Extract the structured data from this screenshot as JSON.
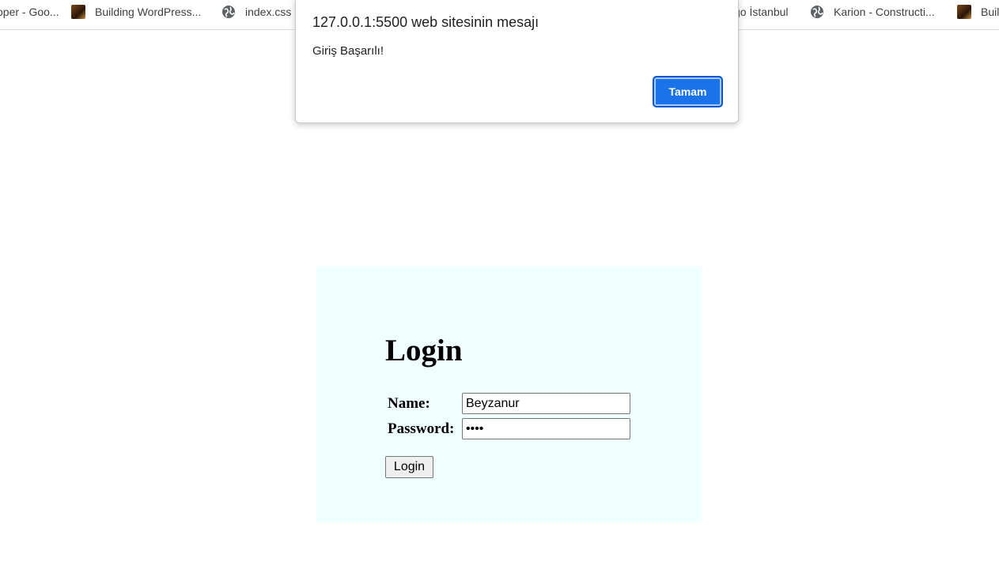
{
  "bookmarks": [
    {
      "label": "oper - Goo...",
      "icon": "globe-icon"
    },
    {
      "label": "Building WordPress...",
      "icon": "site-thumbnail-icon"
    },
    {
      "label": "index.css",
      "icon": "globe-icon"
    },
    {
      "label": "go İstanbul",
      "icon": "none"
    },
    {
      "label": "Karion - Constructi...",
      "icon": "globe-icon"
    },
    {
      "label": "Buil",
      "icon": "site-thumbnail-icon"
    }
  ],
  "alert": {
    "title": "127.0.0.1:5500 web sitesinin mesajı",
    "message": "Giriş Başarılı!",
    "ok_label": "Tamam",
    "ok_color": "#1a73e8"
  },
  "login": {
    "title": "Login",
    "name_label": "Name:",
    "name_value": "Beyzanur",
    "password_label": "Password:",
    "password_value": "••••",
    "button_label": "Login",
    "panel_color": "#f0ffff"
  }
}
